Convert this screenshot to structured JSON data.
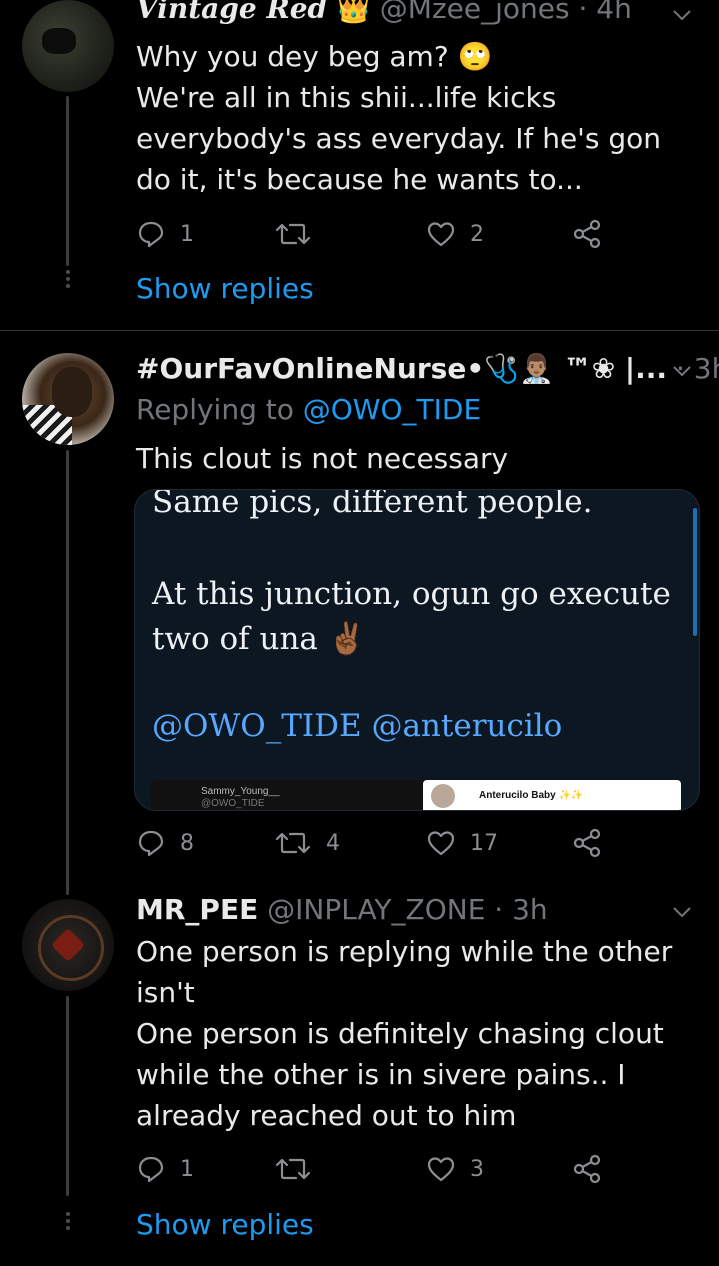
{
  "tweets": [
    {
      "name": "Vintage Red",
      "name_emoji": "👑",
      "handle": "@Mzee_jones",
      "time": "· 4h",
      "text": "Why you dey beg am? 🙄\nWe're all in this shii...life kicks everybody's ass everyday. If he's gon do it, it's because he wants to...",
      "replies": "1",
      "retweets": "",
      "likes": "2",
      "show_replies": "Show replies"
    },
    {
      "name": "#OurFavOnlineNurse•🩺👨🏽‍⚕️ ™❀ |...",
      "time": "· 3h",
      "replying_label": "Replying to",
      "replying_handle": "@OWO_TIDE",
      "text": "This clout is not necessary",
      "replies": "8",
      "retweets": "4",
      "likes": "17",
      "quote": {
        "line1": "Same pics, different people.",
        "line2": "At this junction, ogun go execute",
        "line3": "two of una ✌🏾",
        "mentions": "@OWO_TIDE @anterucilo",
        "thumb1_name": "Sammy_Young__",
        "thumb1_handle": "@OWO_TIDE",
        "thumb2_name": "Anterucilo Baby ✨✨"
      }
    },
    {
      "name": "MR_PEE",
      "handle": "@INPLAY_ZONE",
      "time": "· 3h",
      "text": "One person is replying while the other isn't\nOne person is definitely chasing clout while the other is in sivere pains.. I already reached out to him",
      "replies": "1",
      "retweets": "",
      "likes": "3",
      "show_replies": "Show replies"
    }
  ],
  "colors": {
    "background": "#000000",
    "accent": "#1d9bf0",
    "muted": "#71767b"
  }
}
